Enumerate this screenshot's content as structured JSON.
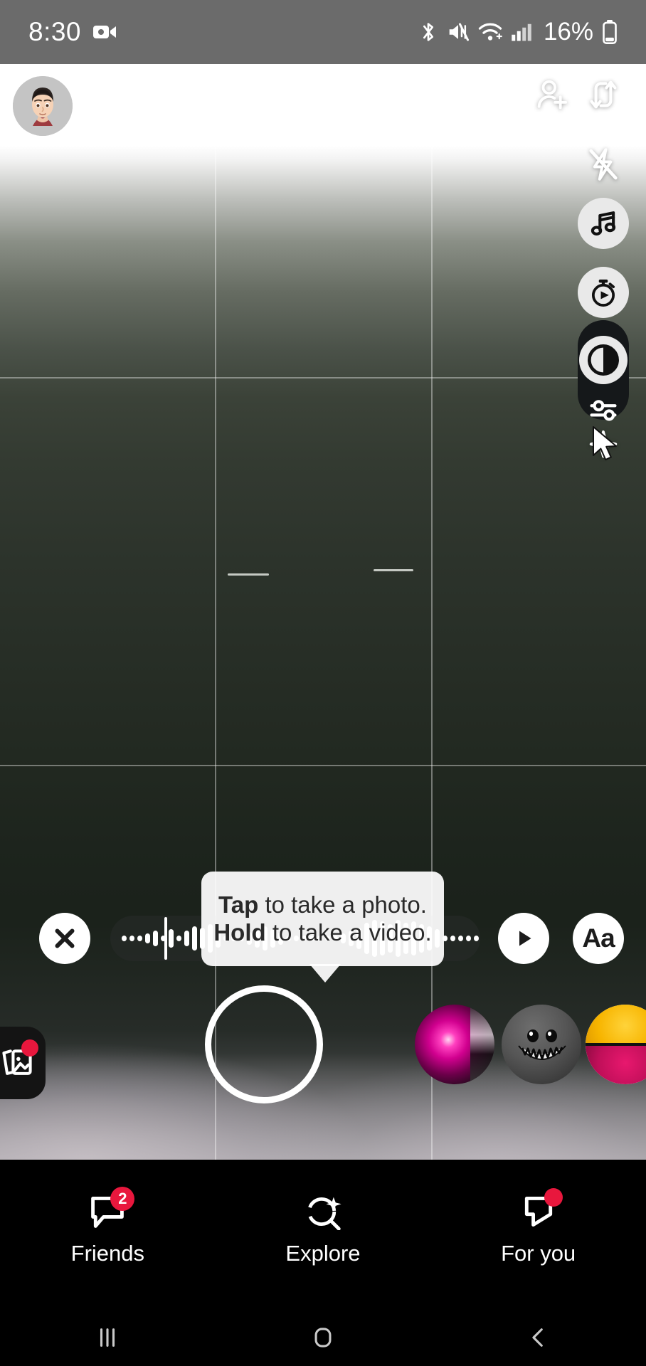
{
  "statusbar": {
    "time": "8:30",
    "battery_percent": "16%",
    "icons": [
      "video-record-icon",
      "bluetooth-icon",
      "sound-mute-icon",
      "wifi-icon",
      "cellular-signal-icon",
      "battery-icon"
    ]
  },
  "camera": {
    "avatar_name": "profile-avatar",
    "grid_enabled": true,
    "tools": [
      {
        "name": "add-friend-icon",
        "label": "Add Friend"
      },
      {
        "name": "camera-flip-icon",
        "label": "Flip Camera"
      },
      {
        "name": "flash-off-icon",
        "label": "Flash Off"
      },
      {
        "name": "music-note-icon",
        "label": "Sounds"
      },
      {
        "name": "timer-icon",
        "label": "Timer"
      },
      {
        "name": "contrast-icon",
        "label": "Filters"
      },
      {
        "name": "sliders-icon",
        "label": "Adjust"
      },
      {
        "name": "sparkle-icon",
        "label": "Effects"
      }
    ]
  },
  "tooltip": {
    "line1_bold": "Tap",
    "line1_rest": " to take a photo.",
    "line2_bold": "Hold",
    "line2_rest": " to take a video."
  },
  "controls": {
    "close_label": "Close",
    "play_label": "Play",
    "text_label": "Aa",
    "capture_label": "Capture",
    "memories_label": "Memories",
    "waveform_heights": [
      8,
      8,
      8,
      14,
      22,
      8,
      26,
      8,
      22,
      34,
      30,
      40,
      26,
      8,
      8,
      8,
      18,
      26,
      34,
      26,
      18,
      8,
      8,
      8,
      8,
      8,
      8,
      8,
      14,
      22,
      30,
      44,
      52,
      48,
      40,
      52,
      44,
      48,
      40,
      34,
      26,
      8,
      8,
      8,
      8,
      8,
      8,
      14,
      34,
      44,
      48,
      40,
      30,
      18,
      8,
      8,
      8,
      8
    ]
  },
  "lenses": [
    {
      "name": "lens-pink-glow"
    },
    {
      "name": "lens-grin-sphere"
    },
    {
      "name": "lens-emoji-split"
    }
  ],
  "bottomnav": {
    "items": [
      {
        "name": "nav-friends",
        "label": "Friends",
        "icon": "chat-bubble-icon",
        "badge": "2",
        "badge_type": "number"
      },
      {
        "name": "nav-explore",
        "label": "Explore",
        "icon": "sparkle-search-icon",
        "badge": "",
        "badge_type": "none"
      },
      {
        "name": "nav-for-you",
        "label": "For you",
        "icon": "play-bubble-icon",
        "badge": "",
        "badge_type": "dot"
      }
    ]
  },
  "sysnav": {
    "recents_label": "Recents",
    "home_label": "Home",
    "back_label": "Back"
  },
  "colors": {
    "accent_red": "#e8173d",
    "statusbar_bg": "#6b6b6b",
    "nav_bg": "#000000"
  }
}
